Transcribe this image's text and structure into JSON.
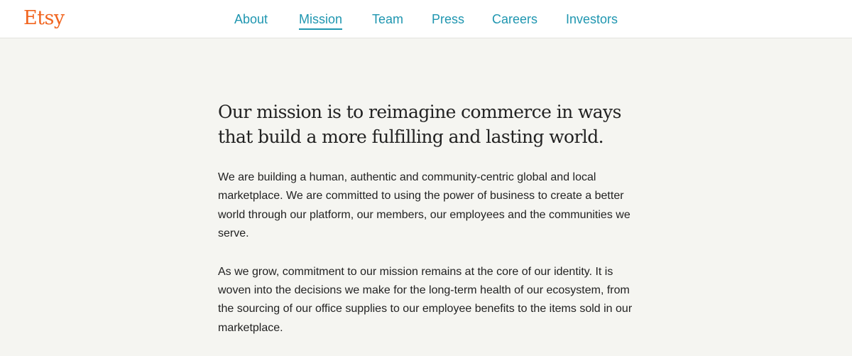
{
  "header": {
    "logo_text": "Etsy",
    "nav": [
      {
        "label": "About"
      },
      {
        "label": "Mission"
      },
      {
        "label": "Team"
      },
      {
        "label": "Press"
      },
      {
        "label": "Careers"
      },
      {
        "label": "Investors"
      }
    ],
    "active_nav": "Mission"
  },
  "main": {
    "headline": "Our mission is to reimagine commerce in ways that build a more fulfilling and lasting world.",
    "paragraphs": [
      "We are building a human, authentic and community-centric global and local marketplace. We are committed to using the power of business to create a better world through our platform, our members, our employees and the communities we serve.",
      "As we grow, commitment to our mission remains at the core of our identity. It is woven into the decisions we make for the long-term health of our ecosystem, from the sourcing of our office supplies to our employee benefits to the items sold in our marketplace."
    ]
  },
  "colors": {
    "brand": "#f1641e",
    "link": "#1f96b0",
    "text": "#222222",
    "page_bg": "#f5f5f1",
    "header_bg": "#ffffff"
  }
}
